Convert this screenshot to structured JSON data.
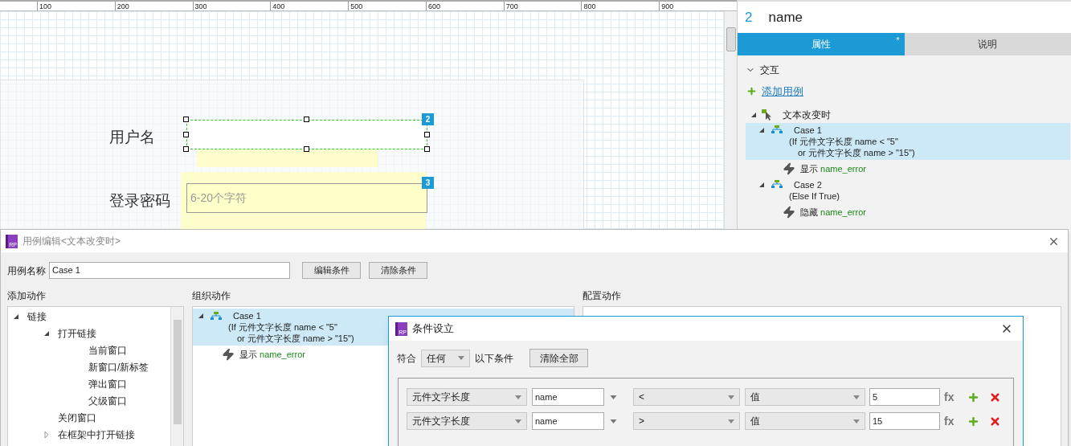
{
  "canvas": {
    "ruler_ticks": [
      "100",
      "200",
      "300",
      "400",
      "500",
      "600",
      "700",
      "800",
      "900"
    ],
    "fields": [
      {
        "label": "用户名",
        "badge": "2",
        "selected": true
      },
      {
        "label": "登录密码",
        "badge": "3",
        "placeholder": "6-20个字符",
        "selected": false
      }
    ]
  },
  "inspector": {
    "widget_number": "2",
    "widget_name": "name",
    "tabs": [
      {
        "label": "属性",
        "selected": true,
        "marker": "*"
      },
      {
        "label": "说明",
        "selected": false
      }
    ],
    "section": {
      "label": "交互",
      "expanded": true
    },
    "add_case": "添加用例",
    "events": [
      {
        "label": "文本改变时",
        "expanded": true,
        "cases": [
          {
            "name": "Case 1",
            "condition_lines": [
              "(If 元件文字长度 name < \"5\"",
              "or 元件文字长度 name > \"15\")"
            ],
            "expanded": true,
            "selected": true,
            "actions": [
              {
                "verb": "显示",
                "target": "name_error"
              }
            ]
          },
          {
            "name": "Case 2",
            "condition_lines": [
              "(Else If True)"
            ],
            "expanded": true,
            "selected": false,
            "actions": [
              {
                "verb": "隐藏",
                "target": "name_error"
              }
            ]
          }
        ]
      }
    ]
  },
  "case_editor": {
    "logo": "RP",
    "title": "用例编辑<文本改变时>",
    "case_name_label": "用例名称",
    "case_name": "Case 1",
    "buttons": [
      "编辑条件",
      "清除条件"
    ],
    "add_actions": {
      "heading": "添加动作",
      "tree": [
        {
          "label": "链接",
          "expanded": true,
          "children": [
            {
              "label": "打开链接",
              "expanded": true,
              "children": [
                {
                  "label": "当前窗口"
                },
                {
                  "label": "新窗口/新标签"
                },
                {
                  "label": "弹出窗口"
                },
                {
                  "label": "父级窗口"
                }
              ]
            },
            {
              "label": "关闭窗口"
            },
            {
              "label": "在框架中打开链接",
              "expanded": false
            }
          ]
        }
      ]
    },
    "organize": {
      "heading": "组织动作",
      "case": {
        "name": "Case 1",
        "condition_lines": [
          "(If 元件文字长度 name < \"5\"",
          "or 元件文字长度 name > \"15\")"
        ],
        "expanded": true,
        "selected": true,
        "actions": [
          {
            "verb": "显示",
            "target": "name_error"
          }
        ]
      }
    },
    "configure": {
      "heading": "配置动作"
    }
  },
  "condition_dialog": {
    "logo": "RP",
    "title": "条件设立",
    "match_label": "符合",
    "match_value": "任何",
    "match_suffix": "以下条件",
    "clear_all": "清除全部",
    "rows": [
      {
        "type": "元件文字长度",
        "target": "name",
        "operator": "<",
        "value_type": "值",
        "value": "5",
        "fx": "fx"
      },
      {
        "type": "元件文字长度",
        "target": "name",
        "operator": ">",
        "value_type": "值",
        "value": "15",
        "fx": "fx"
      }
    ]
  }
}
